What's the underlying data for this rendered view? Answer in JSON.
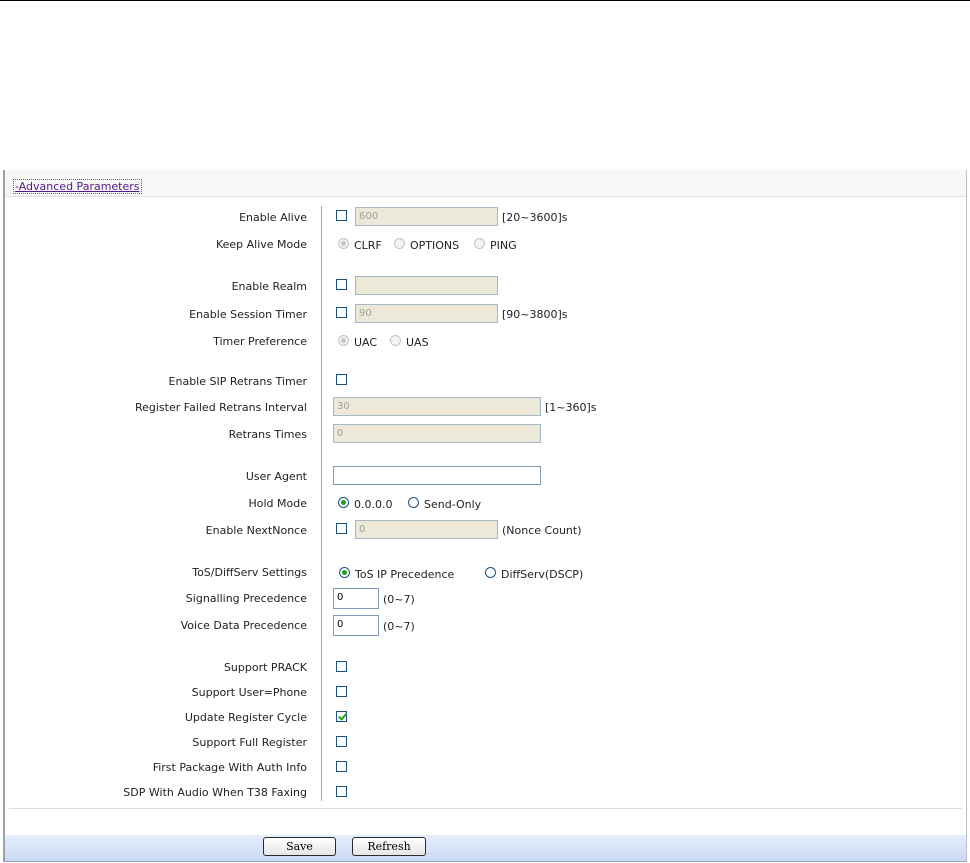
{
  "section": {
    "title": "-Advanced Parameters"
  },
  "enable_alive": {
    "label": "Enable Alive",
    "checked": false,
    "value": "600",
    "range": "[20~3600]s"
  },
  "keep_alive_mode": {
    "label": "Keep Alive Mode",
    "options": [
      "CLRF",
      "OPTIONS",
      "PING"
    ],
    "selected": "CLRF"
  },
  "enable_realm": {
    "label": "Enable Realm",
    "checked": false,
    "value": ""
  },
  "enable_session_timer": {
    "label": "Enable Session Timer",
    "checked": false,
    "value": "90",
    "range": "[90~3800]s"
  },
  "timer_preference": {
    "label": "Timer Preference",
    "options": [
      "UAC",
      "UAS"
    ],
    "selected": "UAC"
  },
  "enable_sip_retrans_timer": {
    "label": "Enable SIP Retrans Timer",
    "checked": false
  },
  "register_failed_retrans_interval": {
    "label": "Register Failed Retrans Interval",
    "value": "30",
    "range": "[1~360]s"
  },
  "retrans_times": {
    "label": "Retrans Times",
    "value": "0"
  },
  "user_agent": {
    "label": "User Agent",
    "value": ""
  },
  "hold_mode": {
    "label": "Hold Mode",
    "options": [
      "0.0.0.0",
      "Send-Only"
    ],
    "selected": "0.0.0.0"
  },
  "enable_nextnonce": {
    "label": "Enable NextNonce",
    "checked": false,
    "value": "0",
    "suffix": "(Nonce Count)"
  },
  "tos_diffserv": {
    "label": "ToS/DiffServ Settings",
    "options": [
      "ToS IP Precedence",
      "DiffServ(DSCP)"
    ],
    "selected": "ToS IP Precedence"
  },
  "signalling_precedence": {
    "label": "Signalling Precedence",
    "value": "0",
    "range": "(0~7)"
  },
  "voice_data_precedence": {
    "label": "Voice Data Precedence",
    "value": "0",
    "range": "(0~7)"
  },
  "support_prack": {
    "label": "Support PRACK",
    "checked": false
  },
  "support_user_phone": {
    "label": "Support User=Phone",
    "checked": false
  },
  "update_register_cycle": {
    "label": "Update Register Cycle",
    "checked": true
  },
  "support_full_register": {
    "label": "Support Full Register",
    "checked": false
  },
  "first_package_auth": {
    "label": "First Package With Auth Info",
    "checked": false
  },
  "sdp_audio_t38": {
    "label": "SDP With Audio When T38 Faxing",
    "checked": false
  },
  "buttons": {
    "save": "Save",
    "refresh": "Refresh"
  }
}
